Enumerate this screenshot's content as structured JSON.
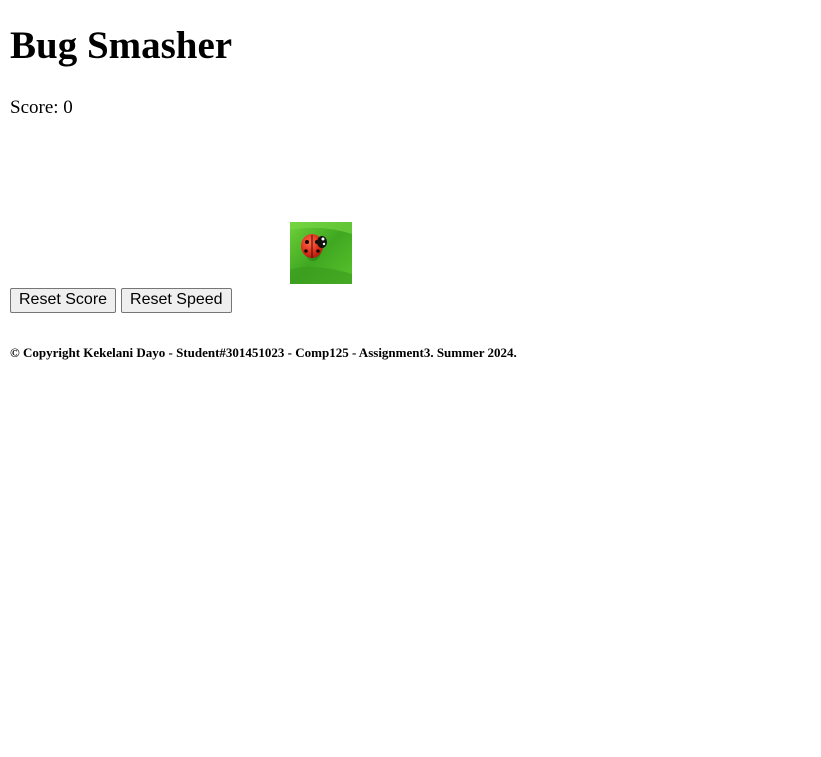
{
  "game": {
    "title": "Bug Smasher",
    "score_text": "Score: 0",
    "bug_icon": "ladybug-icon"
  },
  "controls": {
    "reset_score_label": "Reset Score",
    "reset_speed_label": "Reset Speed"
  },
  "footer": {
    "copyright": "© Copyright Kekelani Dayo - Student#301451023 - Comp125 - Assignment3. Summer 2024."
  },
  "colors": {
    "background": "#ffffff",
    "text": "#000000",
    "grass": "#4caf2a",
    "ladybug_red": "#e0301e"
  }
}
